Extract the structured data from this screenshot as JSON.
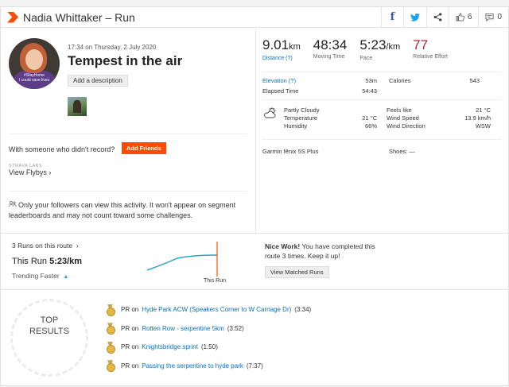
{
  "header": {
    "title": "Nadia Whittaker – Run",
    "kudos_count": "6",
    "comment_count": "0",
    "icons": [
      "facebook-icon",
      "twitter-icon",
      "share-icon",
      "kudos-icon",
      "comment-icon"
    ]
  },
  "activity": {
    "datetime": "17:34 on Thursday, 2 July 2020",
    "name": "Tempest in the air",
    "add_description": "Add a description",
    "avatar_caption_1": "#StayHome",
    "avatar_caption_2": "I could save lives"
  },
  "friends": {
    "text": "With someone who didn't record?",
    "button": "Add Friends"
  },
  "labs": {
    "label": "STRAVA LABS",
    "link": "View Flybys"
  },
  "privacy_text": "Only your followers can view this activity. It won't appear on segment leaderboards and may not count toward some challenges.",
  "stats": {
    "distance": {
      "value": "9.01",
      "unit": "km",
      "label": "Distance (?)"
    },
    "moving_time": {
      "value": "48:34",
      "label": "Moving Time"
    },
    "pace": {
      "value": "5:23",
      "unit": "/km",
      "label": "Pace"
    },
    "effort": {
      "value": "77",
      "label": "Relative Effort"
    }
  },
  "details": {
    "elevation_label": "Elevation (?)",
    "elevation": "53m",
    "calories_label": "Calories",
    "calories": "543",
    "elapsed_label": "Elapsed Time",
    "elapsed": "54:43"
  },
  "weather": {
    "condition": "Partly Cloudy",
    "temperature_label": "Temperature",
    "temperature": "21 °C",
    "humidity_label": "Humidity",
    "humidity": "66%",
    "feels_like_label": "Feels like",
    "feels_like": "21 °C",
    "wind_speed_label": "Wind Speed",
    "wind_speed": "13.9 km/h",
    "wind_direction_label": "Wind Direction",
    "wind_direction": "WSW"
  },
  "gear": {
    "device": "Garmin fēnix 5S Plus",
    "shoes": "Shoes: —"
  },
  "comparison": {
    "runs_on_route": "3 Runs on this route",
    "this_run_label": "This Run",
    "this_run_pace": "5:23/km",
    "trending": "Trending Faster",
    "chart_label": "This Run",
    "nice_bold": "Nice Work!",
    "nice_text": "You have completed this route 3 times. Keep it up!",
    "matched_button": "View Matched Runs"
  },
  "top_results": {
    "label_line1": "TOP",
    "label_line2": "RESULTS",
    "items": [
      {
        "pr": "PR on",
        "segment": "Hyde Park ACW (Speakers Corner to W Carriage Dr)",
        "time": "(3:34)"
      },
      {
        "pr": "PR on",
        "segment": "Rotten Row - serpentine 5km",
        "time": "(3:52)"
      },
      {
        "pr": "PR on",
        "segment": "Knightsbridge sprint",
        "time": "(1:50)"
      },
      {
        "pr": "PR on",
        "segment": "Passing the serpentine to hyde park",
        "time": "(7:37)"
      }
    ]
  },
  "colors": {
    "accent": "#fc4c02",
    "link": "#0571c8",
    "effort": "#bb1e2e",
    "trend_line": "#29a3c5"
  }
}
